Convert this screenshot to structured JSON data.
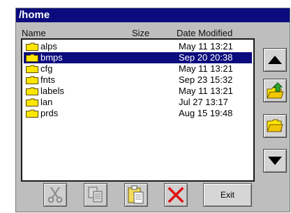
{
  "title": "/home",
  "columns": {
    "name": "Name",
    "size": "Size",
    "date": "Date Modified"
  },
  "files": [
    {
      "name": "alps",
      "date": "May 11 13:21",
      "selected": false
    },
    {
      "name": "bmps",
      "date": "Sep 20 20:38",
      "selected": true
    },
    {
      "name": "cfg",
      "date": "May 11 13:21",
      "selected": false
    },
    {
      "name": "fnts",
      "date": "Sep 23 15:32",
      "selected": false
    },
    {
      "name": "labels",
      "date": "May 11 13:21",
      "selected": false
    },
    {
      "name": "lan",
      "date": "Jul 27 13:17",
      "selected": false
    },
    {
      "name": "prds",
      "date": "Aug 15 19:48",
      "selected": false
    }
  ],
  "buttons": {
    "exit": "Exit"
  },
  "icons": {
    "scroll_up": "up-arrow-icon",
    "parent_folder": "folder-up-icon",
    "open_folder": "open-folder-icon",
    "scroll_down": "down-arrow-icon",
    "cut": "scissors-icon",
    "copy": "copy-icon",
    "paste": "paste-icon",
    "delete": "delete-x-icon"
  },
  "colors": {
    "titlebar": "#0b0b7e",
    "selection": "#0b0b7e",
    "folder": "#ffe600",
    "delete": "#e11010",
    "window": "#bebebe"
  }
}
